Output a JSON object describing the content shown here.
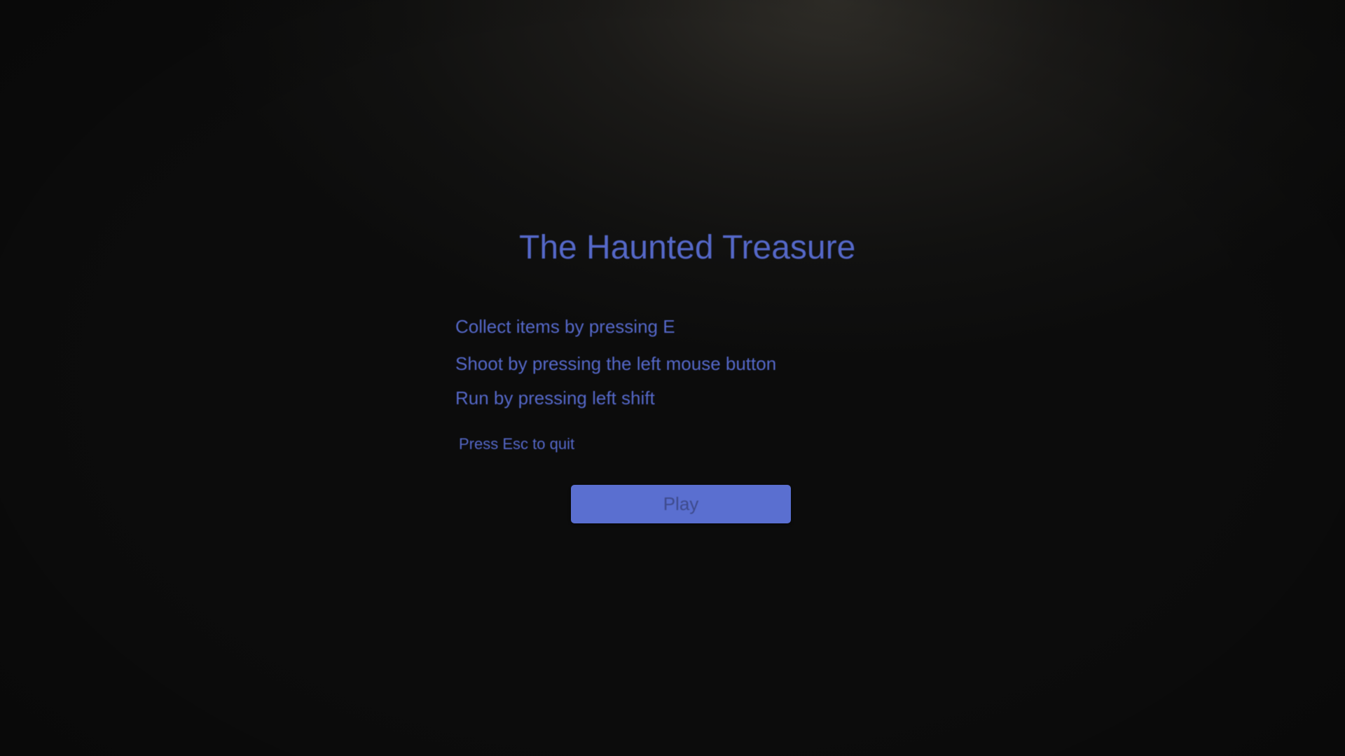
{
  "menu": {
    "title": "The Haunted Treasure",
    "instructions": [
      "Collect items by pressing E",
      "Shoot by pressing the left mouse button",
      "Run by pressing left shift"
    ],
    "quit_hint": "Press Esc to quit",
    "play_label": "Play"
  },
  "colors": {
    "text_accent": "#5568c8",
    "button_fill": "#5a6fd0",
    "button_text": "#3e4b8c"
  }
}
